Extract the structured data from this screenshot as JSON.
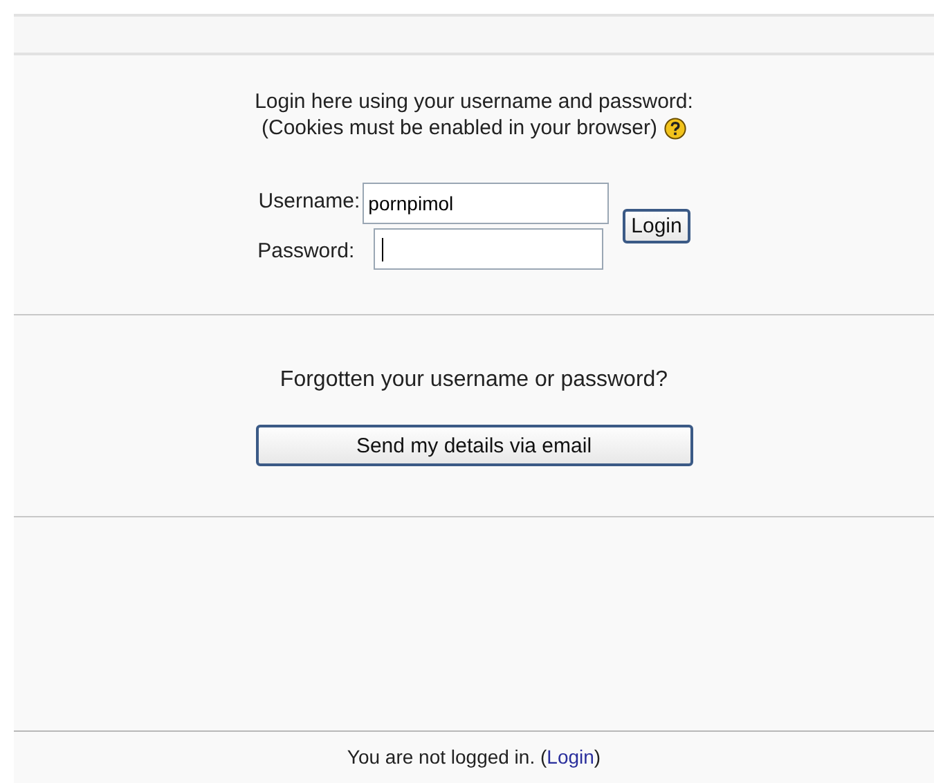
{
  "intro": [
    "Login here using your username and password:",
    "(Cookies must be enabled in your browser)"
  ],
  "form": {
    "username_label": "Username:",
    "username_value": "pornpimol",
    "password_label": "Password:",
    "password_focused": true,
    "login_button": "Login"
  },
  "forgot": {
    "question": "Forgotten your username or password?",
    "button": "Send my details via email"
  },
  "footer": {
    "text_before": "You are not logged in. (",
    "link": "Login",
    "text_after": ")"
  }
}
